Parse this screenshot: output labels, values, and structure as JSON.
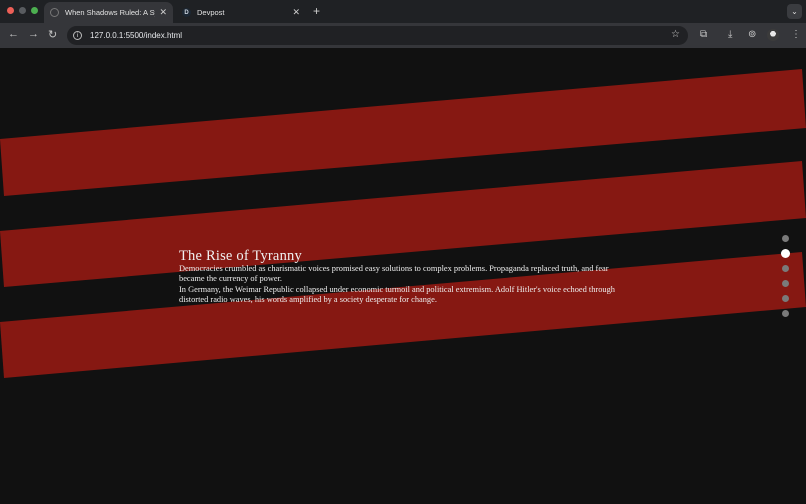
{
  "browser": {
    "tabs": [
      {
        "title": "When Shadows Ruled: A Sym",
        "favicon": "globe-icon",
        "active": true
      },
      {
        "title": "Devpost",
        "favicon": "D",
        "active": false
      }
    ],
    "new_tab_symbol": "+",
    "tab_menu_symbol": "⌄",
    "url": "127.0.0.1:5500/index.html"
  },
  "page": {
    "background": "#111111",
    "stripe_color": "#861812",
    "section": {
      "heading": "The Rise of Tyranny",
      "paragraph_1": "Democracies crumbled as charismatic voices promised easy solutions to complex problems. Propaganda replaced truth, and fear became the currency of power.",
      "paragraph_2": "In Germany, the Weimar Republic collapsed under economic turmoil and political extremism. Adolf Hitler's voice echoed through distorted radio waves, his words amplified by a society desperate for change."
    },
    "section_nav": {
      "count": 6,
      "active_index": 1
    }
  }
}
